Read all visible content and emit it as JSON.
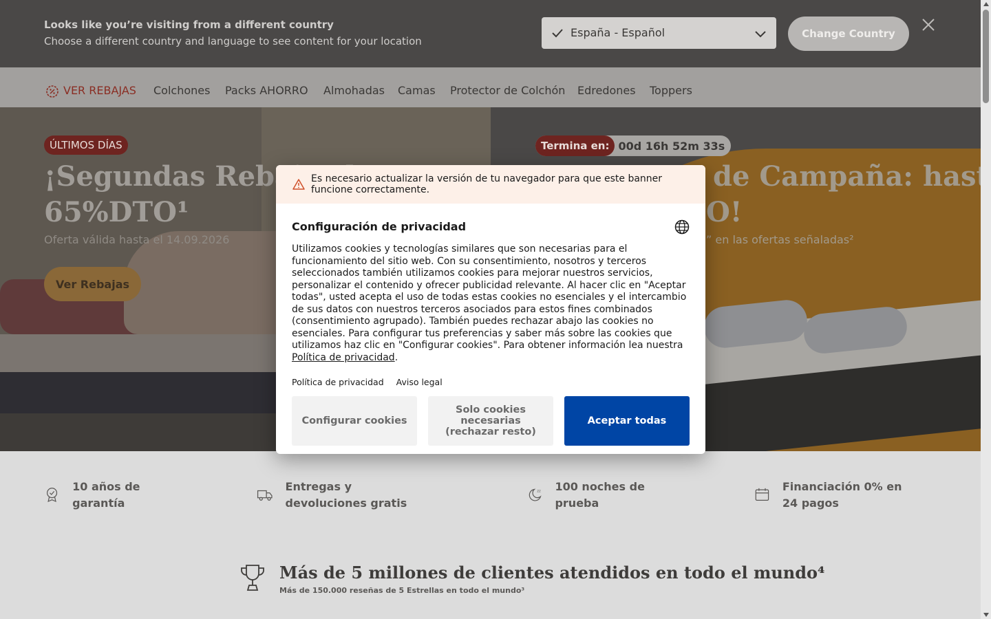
{
  "country_bar": {
    "title": "Looks like you’re visiting from a different country",
    "subtitle": "Choose a different country and language to see content for your location",
    "selected_country": "España - Español",
    "change_button": "Change Country"
  },
  "nav": {
    "items": [
      {
        "label": "VER REBAJAS",
        "highlight": true
      },
      {
        "label": "Colchones"
      },
      {
        "label": "Packs AHORRO"
      },
      {
        "label": "Almohadas"
      },
      {
        "label": "Camas"
      },
      {
        "label": "Protector de Colchón"
      },
      {
        "label": "Edredones"
      },
      {
        "label": "Toppers"
      }
    ]
  },
  "hero_left": {
    "badge": "ÚLTIMOS DÍAS",
    "headline": "¡Segundas Rebajas hasta 65%DTO¹",
    "subtext": "Oferta válida hasta el 14.09.2026",
    "cta": "Ver Rebajas"
  },
  "hero_right": {
    "timer_label": "Termina en:",
    "timer_value": "00d 16h 52m 33s",
    "headline_line1": "de Campaña: hasta",
    "headline_line2": "O!",
    "subtext": "” en las ofertas señaladas²"
  },
  "usps": [
    {
      "icon": "warranty-badge-icon",
      "text": "10 años de garantía"
    },
    {
      "icon": "delivery-truck-icon",
      "text": "Entregas y devoluciones gratis"
    },
    {
      "icon": "moon-sleep-icon",
      "text": "100 noches de prueba"
    },
    {
      "icon": "calendar-icon",
      "text": "Financiación 0% en 24 pagos"
    }
  ],
  "trust": {
    "title": "Más de 5 millones de clientes atendidos en todo el mundo⁴",
    "subtitle": "Más de 150.000 reseñas de 5 Estrellas en todo el mundo³"
  },
  "privacy_modal": {
    "warning": "Es necesario actualizar la versión de tu navegador para que este banner funcione correctamente.",
    "title": "Configuración de privacidad",
    "body": "Utilizamos cookies y tecnologías similares que son necesarias para el funcionamiento del sitio web. Con su consentimiento, nosotros y terceros seleccionados también utilizamos cookies para mejorar nuestros servicios, personalizar el contenido y ofrecer publicidad relevante. Al hacer clic en \"Aceptar todas\", usted acepta el uso de todas estas cookies no esenciales y el intercambio de sus datos con nuestros terceros asociados para estos fines combinados (consentimiento agrupado). También puedes rechazar abajo las cookies no esenciales. Para configurar tus preferencias y saber más sobre las cookies que utilizamos haz clic en \"Configurar cookies\". Para obtener información lea nuestra",
    "body_link": "Política de privacidad",
    "body_end": ".",
    "footer_links": [
      "Política de privacidad",
      "Aviso legal"
    ],
    "buttons": {
      "configure": "Configurar cookies",
      "necessary": "Solo cookies necesarias (rechazar resto)",
      "accept": "Aceptar todas"
    }
  },
  "colors": {
    "accept_button": "#0045a5",
    "sale_red": "#8a2e24",
    "overlay_dim": "rgba(0,0,0,0.55)"
  }
}
